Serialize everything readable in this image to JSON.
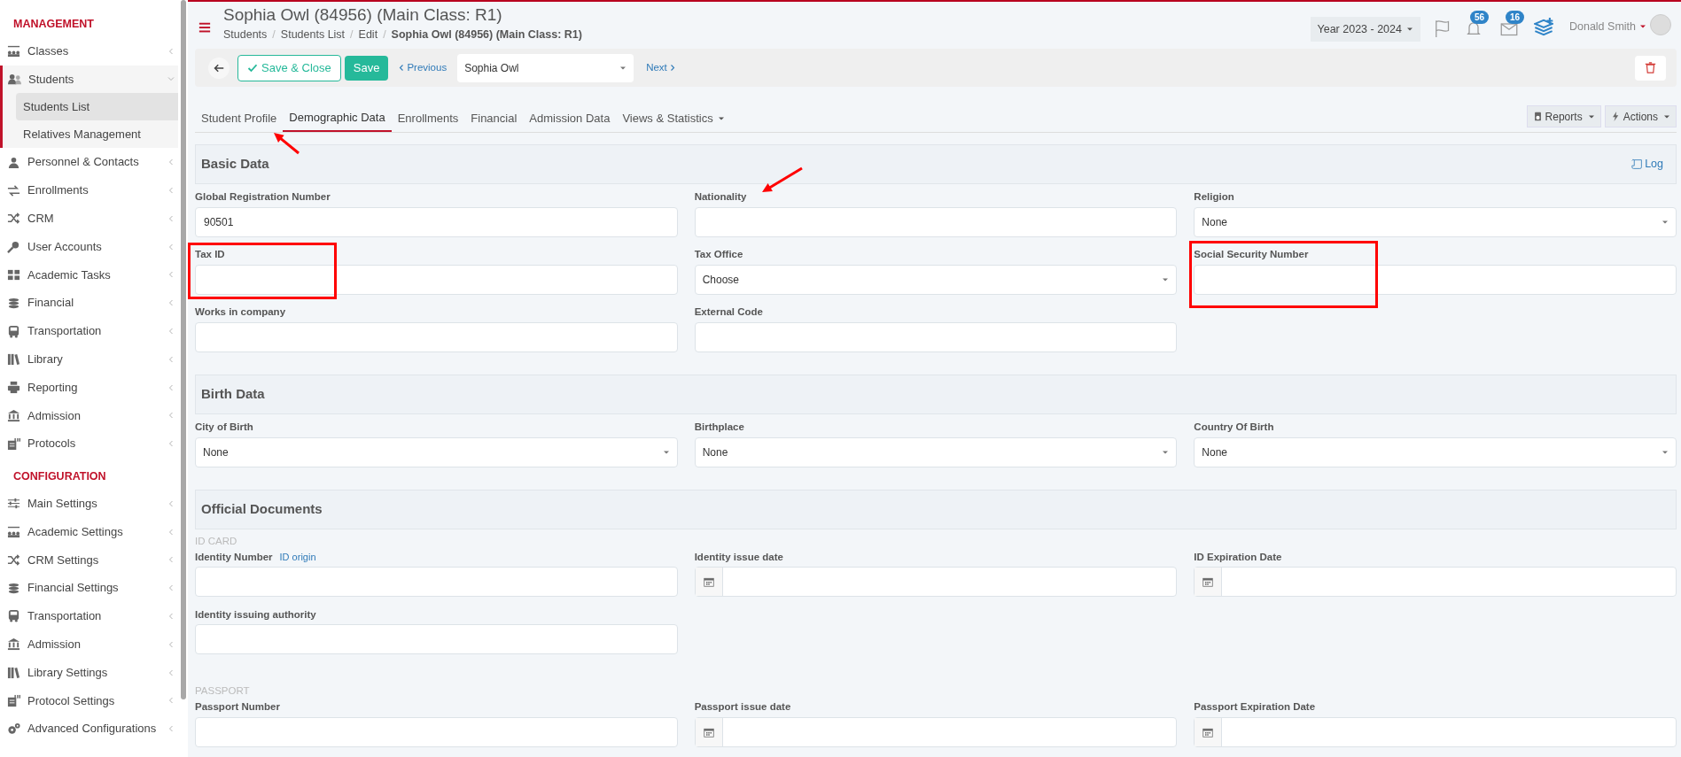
{
  "sidebar": {
    "sections": [
      {
        "title": "MANAGEMENT",
        "items": [
          {
            "label": "Classes",
            "expanded": false,
            "selected": false
          },
          {
            "label": "Students",
            "expanded": true,
            "selected": false,
            "children": [
              {
                "label": "Students List",
                "selected": true
              },
              {
                "label": "Relatives Management",
                "selected": false
              }
            ]
          },
          {
            "label": "Personnel & Contacts",
            "expanded": false,
            "selected": false
          },
          {
            "label": "Enrollments",
            "expanded": false,
            "selected": false
          },
          {
            "label": "CRM",
            "expanded": false,
            "selected": false
          },
          {
            "label": "User Accounts",
            "expanded": false,
            "selected": false
          },
          {
            "label": "Academic Tasks",
            "expanded": false,
            "selected": false
          },
          {
            "label": "Financial",
            "expanded": false,
            "selected": false
          },
          {
            "label": "Transportation",
            "expanded": false,
            "selected": false
          },
          {
            "label": "Library",
            "expanded": false,
            "selected": false
          },
          {
            "label": "Reporting",
            "expanded": false,
            "selected": false
          },
          {
            "label": "Admission",
            "expanded": false,
            "selected": false
          },
          {
            "label": "Protocols",
            "expanded": false,
            "selected": false
          }
        ]
      },
      {
        "title": "CONFIGURATION",
        "items": [
          {
            "label": "Main Settings",
            "expanded": false,
            "selected": false
          },
          {
            "label": "Academic Settings",
            "expanded": false,
            "selected": false
          },
          {
            "label": "CRM Settings",
            "expanded": false,
            "selected": false
          },
          {
            "label": "Financial Settings",
            "expanded": false,
            "selected": false
          },
          {
            "label": "Transportation",
            "expanded": false,
            "selected": false
          },
          {
            "label": "Admission",
            "expanded": false,
            "selected": false
          },
          {
            "label": "Library Settings",
            "expanded": false,
            "selected": false
          },
          {
            "label": "Protocol Settings",
            "expanded": false,
            "selected": false
          },
          {
            "label": "Advanced Configurations",
            "expanded": false,
            "selected": false
          }
        ]
      }
    ]
  },
  "header": {
    "title": "Sophia Owl (84956) (Main Class: R1)",
    "breadcrumb_separator": "/",
    "breadcrumb": [
      "Students",
      "Students List",
      "Edit",
      "Sophia Owl (84956) (Main Class: R1)"
    ],
    "year": "Year 2023 - 2024",
    "notifications": "56",
    "messages": "16",
    "user": "Donald Smith"
  },
  "toolbar": {
    "save_close": "Save & Close",
    "save": "Save",
    "previous": "Previous",
    "student_select": "Sophia Owl",
    "next": "Next"
  },
  "tabs": [
    {
      "label": "Student Profile",
      "selected": false,
      "dropdown": false
    },
    {
      "label": "Demographic Data",
      "selected": true,
      "dropdown": false
    },
    {
      "label": "Enrollments",
      "selected": false,
      "dropdown": false
    },
    {
      "label": "Financial",
      "selected": false,
      "dropdown": false
    },
    {
      "label": "Admission Data",
      "selected": false,
      "dropdown": false
    },
    {
      "label": "Views & Statistics",
      "selected": false,
      "dropdown": true
    }
  ],
  "tab_actions": [
    "Reports",
    "Actions"
  ],
  "sections": [
    {
      "title": "Basic Data",
      "log": "Log",
      "groups": [
        {
          "fields": [
            {
              "label": "Global Registration Number",
              "kind": "text",
              "value": "90501"
            },
            {
              "label": "Nationality",
              "kind": "text"
            },
            {
              "label": "Religion",
              "kind": "select",
              "value": "None"
            },
            {
              "label": "Tax ID",
              "kind": "text"
            },
            {
              "label": "Tax Office",
              "kind": "select",
              "value": "Choose"
            },
            {
              "label": "Social Security Number",
              "kind": "text"
            },
            {
              "label": "Works in company",
              "kind": "text"
            },
            {
              "label": "External Code",
              "kind": "text"
            }
          ]
        }
      ]
    },
    {
      "title": "Birth Data",
      "groups": [
        {
          "fields": [
            {
              "label": "City of Birth",
              "kind": "select",
              "value": "None"
            },
            {
              "label": "Birthplace",
              "kind": "select",
              "value": "None"
            },
            {
              "label": "Country Of Birth",
              "kind": "select",
              "value": "None"
            }
          ]
        }
      ]
    },
    {
      "title": "Official Documents",
      "groups": [
        {
          "caption": "ID CARD",
          "fields": [
            {
              "label": "Identity Number",
              "link": "ID origin",
              "kind": "text"
            },
            {
              "label": "Identity issue date",
              "kind": "date"
            },
            {
              "label": "ID Expiration Date",
              "kind": "date"
            },
            {
              "label": "Identity issuing authority",
              "kind": "text"
            }
          ]
        },
        {
          "caption": "PASSPORT",
          "fields": [
            {
              "label": "Passport Number",
              "kind": "text"
            },
            {
              "label": "Passport issue date",
              "kind": "date"
            },
            {
              "label": "Passport Expiration Date",
              "kind": "date"
            }
          ]
        }
      ]
    }
  ]
}
